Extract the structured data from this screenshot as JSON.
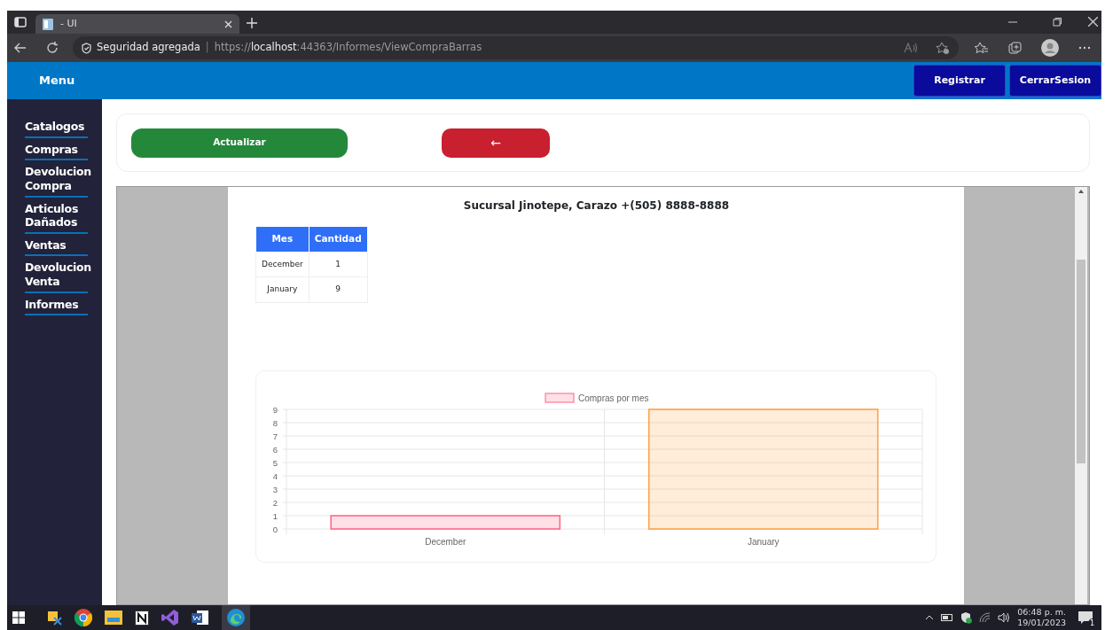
{
  "browser": {
    "tab": {
      "title": "- UI",
      "selected": true
    },
    "address": {
      "security": "Seguridad agregada",
      "separator": "|",
      "url_prefix": "https://",
      "url_host": "localhost",
      "url_rest": ":44363/Informes/ViewCompraBarras"
    }
  },
  "navbar": {
    "brand": "Menu",
    "buttons": [
      "Registrar",
      "CerrarSesion"
    ]
  },
  "sidebar": {
    "items": [
      "Catalogos",
      "Compras",
      "Devolucion Compra",
      "Articulos Dañados",
      "Ventas",
      "Devolucion Venta",
      "Informes"
    ]
  },
  "toolbar": {
    "buttons": [
      {
        "kind": "refresh",
        "label": "Actualizar"
      },
      {
        "kind": "back",
        "label": "←"
      }
    ]
  },
  "report": {
    "title": "Sucursal Jinotepe, Carazo +(505) 8888-8888",
    "table": {
      "columns": [
        "Mes",
        "Cantidad"
      ],
      "rows": [
        [
          "December",
          "1"
        ],
        [
          "January",
          "9"
        ]
      ]
    },
    "chart_data": {
      "type": "bar",
      "categories": [
        "December",
        "January"
      ],
      "series": [
        {
          "name": "Compras por mes",
          "color": [
            "#ff6384",
            "#ff9f40"
          ],
          "values": [
            1,
            9
          ]
        }
      ],
      "grid": true,
      "ylim": [
        0,
        9
      ],
      "yticks": [
        0,
        1,
        2,
        3,
        4,
        5,
        6,
        7,
        8,
        9
      ]
    }
  },
  "taskbar": {
    "time": "06:48 p. m.",
    "date": "19/01/2023",
    "notifications": "1"
  }
}
